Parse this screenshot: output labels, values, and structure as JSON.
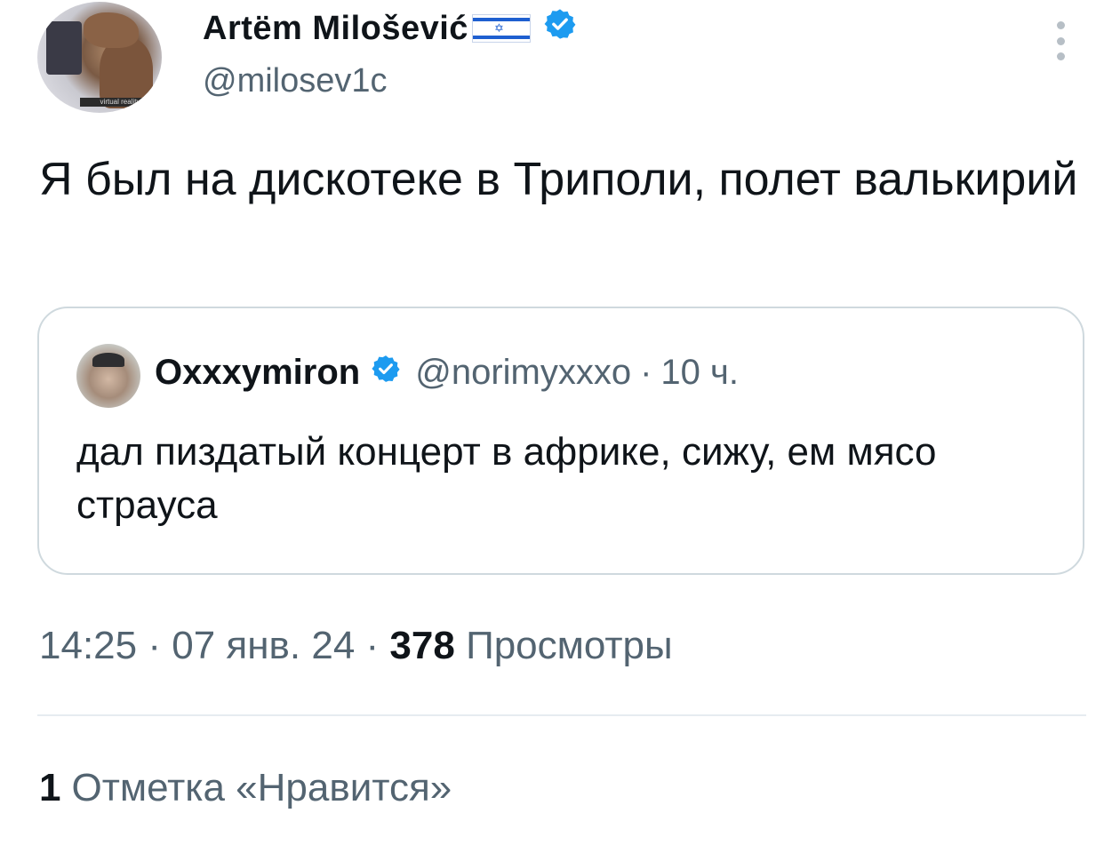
{
  "author": {
    "name": "Artёm Milošević",
    "handle": "@milosev1c",
    "avatar_caption": "virtual reality"
  },
  "tweet": {
    "text": "Я был на дискотеке в Триполи, полет валькирий"
  },
  "quoted_tweet": {
    "name": "Oxxxymiron",
    "handle": "@norimyxxxo",
    "separator": "·",
    "time": "10 ч.",
    "text": "дал пиздатый концерт в африке, сижу, ем мясо страуса"
  },
  "meta": {
    "time": "14:25",
    "sep1": "·",
    "date": "07 янв. 24",
    "sep2": "·",
    "views_count": "378",
    "views_label": "Просмотры"
  },
  "likes": {
    "count": "1",
    "label": "Отметка «Нравится»"
  },
  "colors": {
    "verified": "#1d9bf0",
    "text_secondary": "#536471",
    "border": "#cfd9de"
  },
  "icons": [
    "flag-israel-icon",
    "verified-badge-icon",
    "more-options-icon"
  ]
}
